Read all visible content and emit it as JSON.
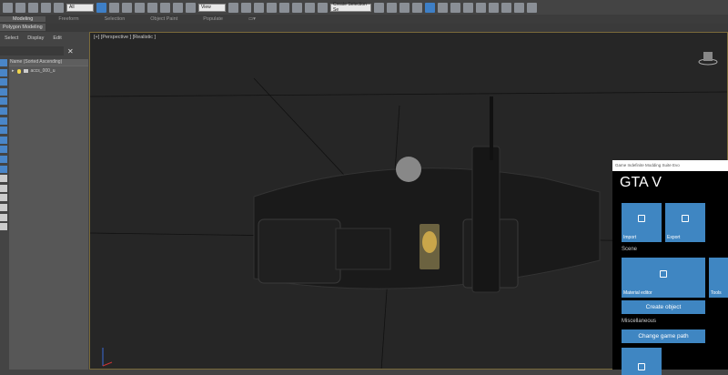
{
  "toolbar": {
    "selection_filter": "All",
    "ref_coord": "View",
    "named_selection": "Create Selection Se"
  },
  "ribbon": {
    "tabs": [
      "Modeling",
      "Freeform",
      "Selection",
      "Object Paint",
      "Populate"
    ],
    "active": "Modeling",
    "subtab": "Polygon Modeling"
  },
  "scene_explorer": {
    "menu": [
      "Select",
      "Display",
      "Edit"
    ],
    "column_header": "Name (Sorted Ascending)",
    "items": [
      {
        "name": "accs_000_u"
      }
    ]
  },
  "viewport": {
    "label": "[+] [Perspective ] [Realistic ]"
  },
  "gimms": {
    "window_title": "Game Indefinite Modding Suite Evo",
    "heading": "GTA V",
    "import": "Import",
    "export": "Export",
    "scene_label": "Scene",
    "material_editor": "Material editor",
    "tools": "Tools",
    "create_object": "Create object",
    "misc_label": "Miscellaneous",
    "change_game_path": "Change game path"
  },
  "colors": {
    "accent": "#3f86c2",
    "viewport_bg": "#262626"
  }
}
